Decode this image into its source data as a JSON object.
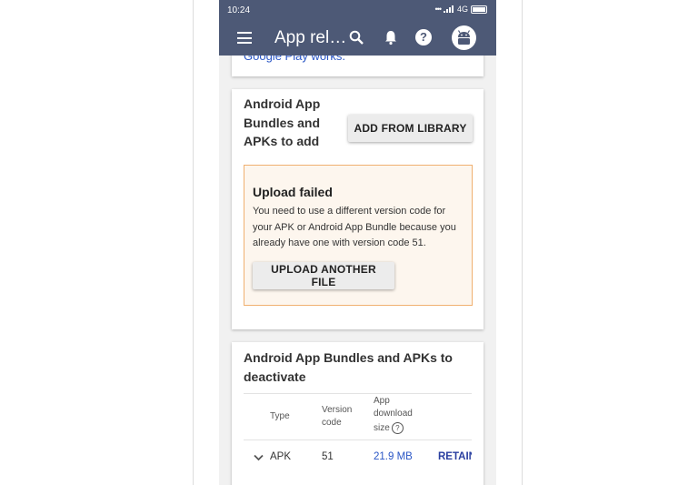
{
  "status_bar": {
    "time": "10:24",
    "network": "4G"
  },
  "app_bar": {
    "title": "App rel…",
    "icons": [
      "menu-icon",
      "search-icon",
      "bell-icon",
      "help-icon",
      "avatar"
    ]
  },
  "top_card": {
    "link_text": "Google Play works."
  },
  "add_card": {
    "heading_lines": [
      "Android App",
      "Bundles and",
      "APKs to add"
    ],
    "add_button": "ADD FROM LIBRARY",
    "error": {
      "title": "Upload failed",
      "message": "You need to use a different version code for your APK or Android App Bundle because you already have one with version code 51.",
      "button": "UPLOAD ANOTHER FILE"
    }
  },
  "deactivate_card": {
    "heading_lines": [
      "Android App Bundles and APKs to",
      "deactivate"
    ],
    "columns": {
      "type": "Type",
      "version_code_lines": [
        "Version",
        "code"
      ],
      "download_size_lines": [
        "App",
        "download",
        "size"
      ]
    },
    "rows": [
      {
        "type": "APK",
        "version_code": "51",
        "download_size": "21.9 MB",
        "action": "RETAIN"
      }
    ]
  },
  "colors": {
    "app_bar": "#4d5976",
    "link": "#2a56c6",
    "error_border": "#f0b070",
    "error_bg": "#fdf6ee"
  }
}
